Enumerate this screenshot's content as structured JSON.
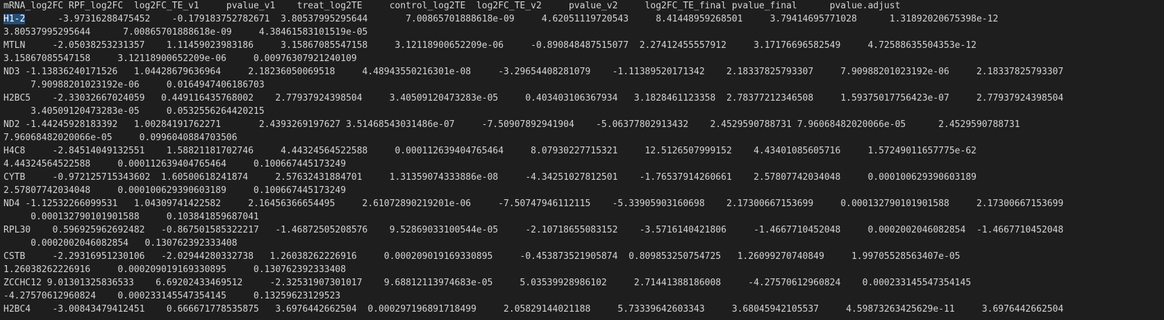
{
  "file": {
    "header": "mRNA_log2FC RPF_log2FC  log2FC_TE_v1     pvalue_v1    treat_log2TE     control_log2TE  log2FC_TE_v2     pvalue_v2     log2FC_TE_final pvalue_final      pvalue.adjust",
    "lines": [
      {
        "selected": "H1-2",
        "rest": "      -3.97316288475452    -0.179183752782671  3.80537995295644       7.00865701888618e-09     4.62051119720543     8.41448959268501     3.79414695771028      1.31892020675398e-12"
      },
      {
        "text": "3.80537995295644      7.00865701888618e-09     4.38461583101519e-05"
      },
      {
        "text": "MTLN     -2.05038253231357    1.11459023983186     3.15867085547158     3.12118900652209e-06     -0.890848487515077  2.27412455557912     3.17176696582549     4.72588635504353e-12"
      },
      {
        "text": "3.15867085547158     3.12118900652209e-06     0.00976307921240109"
      },
      {
        "text": "ND3 -1.13836240171526   1.04428679636964     2.18236050069518     4.48943550216301e-08     -3.29654408281079    -1.11389520171342    2.18337825793307     7.90988201023192e-06     2.18337825793307"
      },
      {
        "text": "     7.90988201023192e-06     0.0164947406186703"
      },
      {
        "text": "H2BC5    -2.33032667024059   0.449116435768002    2.77937924398504     3.40509120473283e-05     0.403403106367934   3.1828461123358  2.78377212346508     1.59375017756423e-07     2.77937924398504"
      },
      {
        "text": "     3.40509120473283e-05     0.0532556264420215"
      },
      {
        "text": "ND2 -1.44245928183392   1.00284191762271       2.4393269197627 3.51468543031486e-07     -7.50907892941904    -5.06377802913432    2.4529590788731 7.96068482020066e-05      2.4529590788731"
      },
      {
        "text": "7.96068482020066e-05     0.0996040884703506"
      },
      {
        "text": "H4C8     -2.84514049132551    1.58821181702746     4.44324564522588     0.000112639404765464     8.07930227715321     12.5126507999152    4.43401085605716     1.57249011657775e-62"
      },
      {
        "text": "4.44324564522588     0.000112639404765464     0.100667445173249"
      },
      {
        "text": "CYTB     -0.972125715343602  1.60500618241874     2.57632431884701     1.31359074333886e-08     -4.34251027812501    -1.76537914260661    2.57807742034048     0.000100629390603189"
      },
      {
        "text": "2.57807742034048     0.000100629390603189     0.100667445173249"
      },
      {
        "text": "ND4 -1.12532266099531   1.04309741422582     2.16456366654495     2.61072890219201e-06     -7.50747946112115    -5.33905903160698    2.17300667153699     0.000132790101901588     2.17300667153699"
      },
      {
        "text": "     0.000132790101901588     0.103841859687041"
      },
      {
        "text": "RPL30    0.596925962692482   -0.867501585322217   -1.46872505208576    9.52869033100544e-05     -2.10718655083152    -3.5716140421806     -1.4667710452048     0.0002002046082854  -1.4667710452048"
      },
      {
        "text": "     0.0002002046082854   0.130762392333408"
      },
      {
        "text": "CSTB     -2.29316951230106   -2.02944280332738   1.26038262226916     0.000209019169330895     -0.453873521905874  0.809853250754725   1.26099270740849     1.99705528563407e-05"
      },
      {
        "text": "1.26038262226916     0.000209019169330895     0.130762392333408"
      },
      {
        "text": "ZCCHC12 9.01301325836533    6.69202433469512     -2.32531907301017    9.68812113974683e-05     5.03539928986102     2.71441388186008     -4.27570612960824    0.000233145547354145"
      },
      {
        "text": "-4.27570612960824    0.000233145547354145     0.13259623129523"
      },
      {
        "text": "H2BC4    -3.00843479412451    0.666671778535875   3.6976442662504  0.000297196891718499     2.05829144021188     5.73339642603343     3.68045942105537     4.59873263425629e-11     3.6976442662504"
      }
    ]
  }
}
